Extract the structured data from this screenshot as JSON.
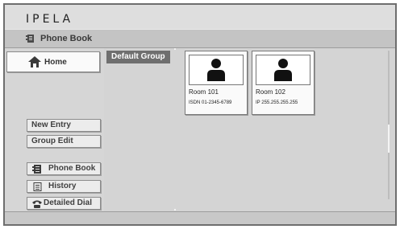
{
  "brand": {
    "logo": "IPELA"
  },
  "header": {
    "title": "Phone Book"
  },
  "sidebar": {
    "home_label": "Home",
    "actions": [
      {
        "label": "New Entry"
      },
      {
        "label": "Group Edit"
      }
    ],
    "modes": [
      {
        "label": "Phone Book",
        "icon": "phonebook-icon"
      },
      {
        "label": "History",
        "icon": "history-icon"
      },
      {
        "label": "Detailed Dial",
        "icon": "phone-dial-icon"
      }
    ]
  },
  "main": {
    "group_label": "Default Group",
    "entries": [
      {
        "name": "Room 101",
        "address": "ISDN 01-2345-6789",
        "icon": "person-icon"
      },
      {
        "name": "Room 102",
        "address": "IP 255.255.255.255",
        "icon": "person-icon"
      }
    ]
  },
  "colors": {
    "background": "#d6d6d6",
    "group_label_bg": "#6f6f6f",
    "card_bg": "#fafafa"
  }
}
